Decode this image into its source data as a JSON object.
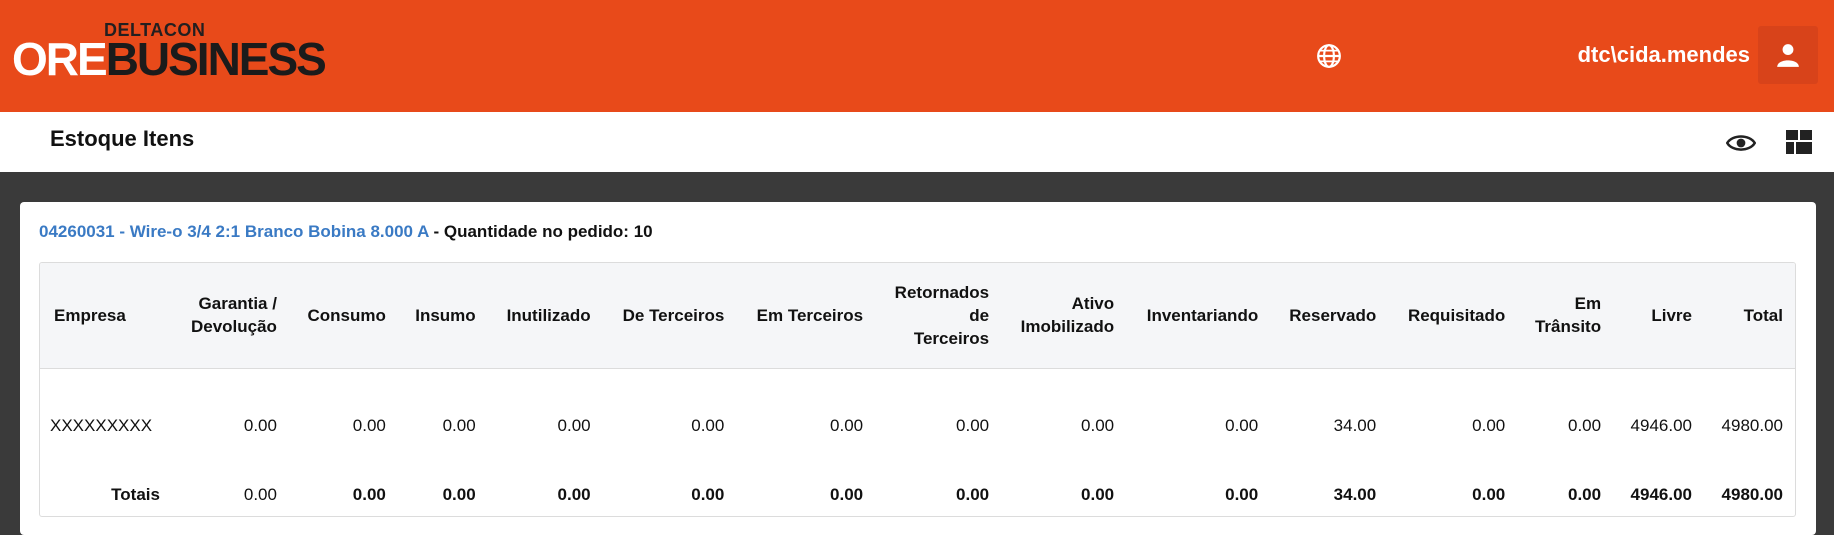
{
  "header": {
    "logo_top": "DELTACON",
    "logo_part1": "ORE",
    "logo_part2": "BUSINESS",
    "username": "dtc\\cida.mendes",
    "accent_color": "#e84a1a"
  },
  "subheader": {
    "title": "Estoque Itens"
  },
  "panel": {
    "item_link": "04260031 - Wire-o 3/4 2:1 Branco Bobina 8.000 A",
    "item_suffix": " - Quantidade no pedido: 10"
  },
  "table": {
    "headers": [
      [
        "Empresa"
      ],
      [
        "Garantia /",
        "Devolução"
      ],
      [
        "Consumo"
      ],
      [
        "Insumo"
      ],
      [
        "Inutilizado"
      ],
      [
        "De Terceiros"
      ],
      [
        "Em Terceiros"
      ],
      [
        "Retornados",
        "de",
        "Terceiros"
      ],
      [
        "Ativo",
        "Imobilizado"
      ],
      [
        "Inventariando"
      ],
      [
        "Reservado"
      ],
      [
        "Requisitado"
      ],
      [
        "Em",
        "Trânsito"
      ],
      [
        "Livre"
      ],
      [
        "Total"
      ]
    ],
    "row": [
      "XXXXXXXXX",
      "0.00",
      "0.00",
      "0.00",
      "0.00",
      "0.00",
      "0.00",
      "0.00",
      "0.00",
      "0.00",
      "34.00",
      "0.00",
      "0.00",
      "4946.00",
      "4980.00"
    ],
    "totals": [
      "Totais",
      "0.00",
      "0.00",
      "0.00",
      "0.00",
      "0.00",
      "0.00",
      "0.00",
      "0.00",
      "0.00",
      "34.00",
      "0.00",
      "0.00",
      "4946.00",
      "4980.00"
    ]
  }
}
